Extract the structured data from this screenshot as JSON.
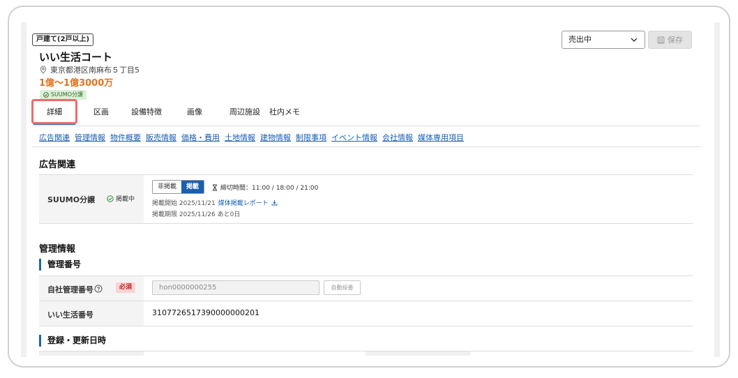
{
  "property": {
    "type_badge": "戸建て(2戸以上)",
    "name": "いい生活コート",
    "address": "東京都港区南麻布５丁目5",
    "price": "1億〜1億3000万",
    "suumo_tag": "SUUMO分譲"
  },
  "header": {
    "status_value": "売出中",
    "save_label": "保存"
  },
  "tabs": [
    {
      "label": "詳細"
    },
    {
      "label": "区画"
    },
    {
      "label": "設備特徴"
    },
    {
      "label": "画像"
    },
    {
      "label": "周辺施設"
    },
    {
      "label": "社内メモ"
    }
  ],
  "anchor_links": [
    "広告関連",
    "管理情報",
    "物件概要",
    "販売情報",
    "価格・費用",
    "土地情報",
    "建物情報",
    "制限事項",
    "イベント情報",
    "会社情報",
    "媒体専用項目"
  ],
  "ad_section": {
    "title": "広告関連",
    "row_label": "SUUMO分譲",
    "posting_status": "掲載中",
    "toggle_off": "非掲載",
    "toggle_on": "掲載",
    "deadline": "締切時間：11:00 / 18:00 / 21:00",
    "pub_start": "掲載開始 2025/11/21",
    "report_link": "媒体掲載レポート",
    "pub_end": "掲載期限 2025/11/26 あと0日"
  },
  "mgmt_section": {
    "title": "管理情報",
    "sub_title": "管理番号",
    "company_id_label": "自社管理番号",
    "required": "必須",
    "company_id_value": "hon0000000255",
    "auto_number": "自動採番",
    "ii_number_label": "いい生活番号",
    "ii_number_value": "3107726517390000000201",
    "dates_sub_title": "登録・更新日時"
  },
  "colors": {
    "accent": "#1b66b3",
    "price": "#e0731d",
    "highlight": "#ef6a6a"
  }
}
